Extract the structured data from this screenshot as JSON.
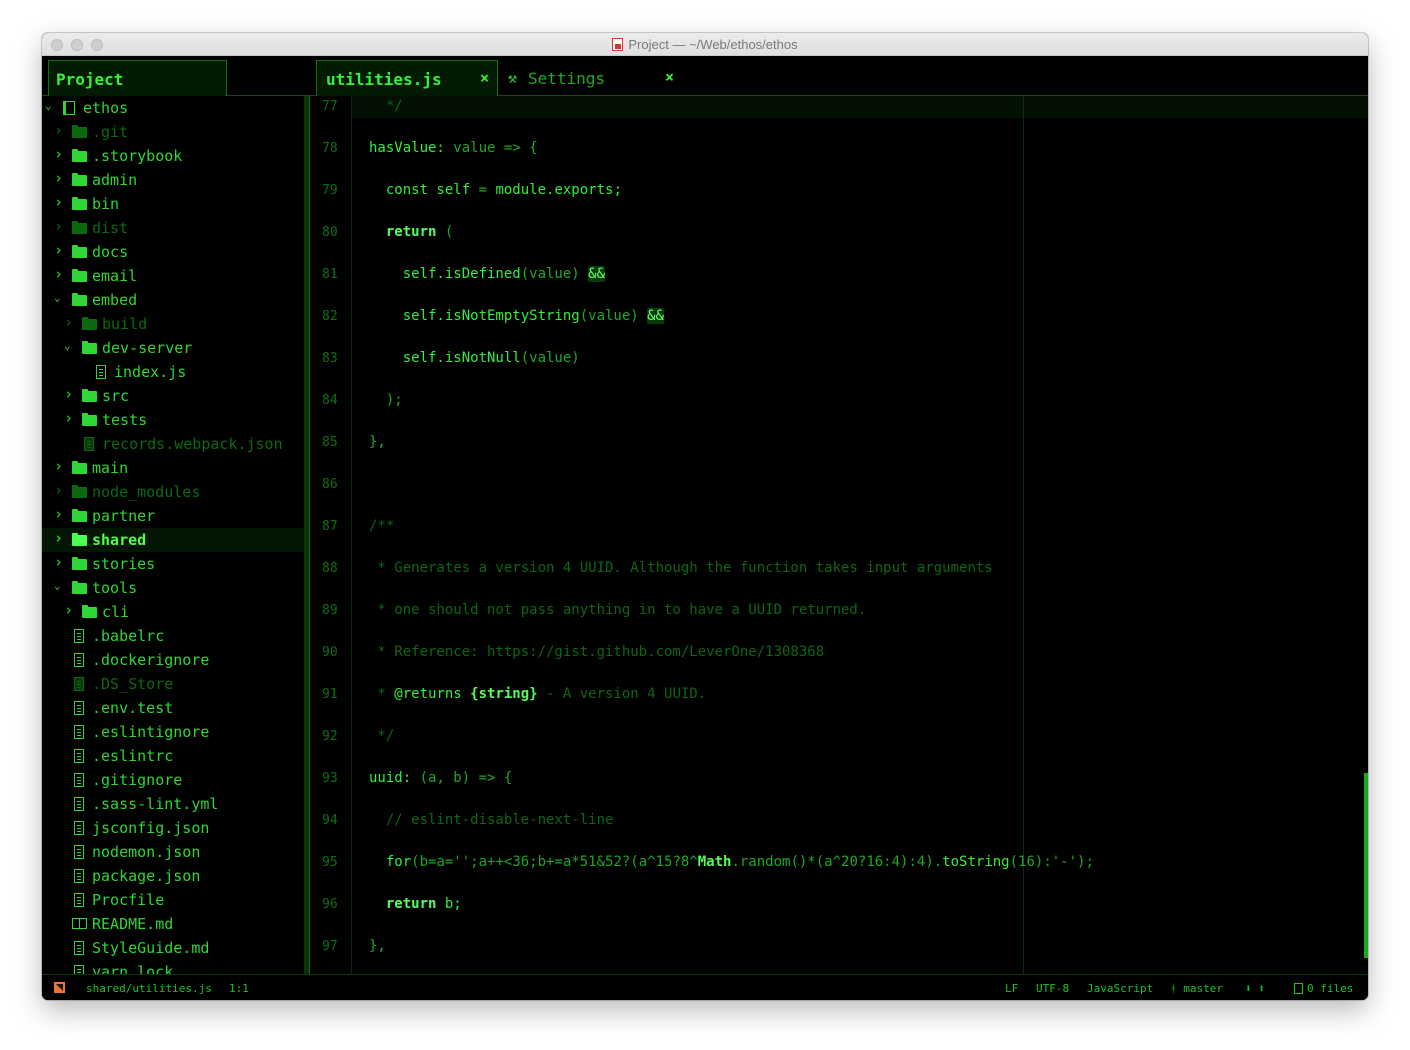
{
  "window": {
    "title": "Project — ~/Web/ethos/ethos"
  },
  "tree": {
    "tab_label": "Project",
    "items": [
      {
        "label": "ethos",
        "kind": "book",
        "depth": 0,
        "expanded": true,
        "state": "normal"
      },
      {
        "label": ".git",
        "kind": "folder",
        "depth": 1,
        "expanded": false,
        "state": "dim"
      },
      {
        "label": ".storybook",
        "kind": "folder",
        "depth": 1,
        "expanded": false,
        "state": "normal"
      },
      {
        "label": "admin",
        "kind": "folder",
        "depth": 1,
        "expanded": false,
        "state": "normal"
      },
      {
        "label": "bin",
        "kind": "folder",
        "depth": 1,
        "expanded": false,
        "state": "normal"
      },
      {
        "label": "dist",
        "kind": "folder",
        "depth": 1,
        "expanded": false,
        "state": "dim"
      },
      {
        "label": "docs",
        "kind": "folder",
        "depth": 1,
        "expanded": false,
        "state": "normal"
      },
      {
        "label": "email",
        "kind": "folder",
        "depth": 1,
        "expanded": false,
        "state": "normal"
      },
      {
        "label": "embed",
        "kind": "folder",
        "depth": 1,
        "expanded": true,
        "state": "normal"
      },
      {
        "label": "build",
        "kind": "folder",
        "depth": 2,
        "expanded": false,
        "state": "dim"
      },
      {
        "label": "dev-server",
        "kind": "folder",
        "depth": 2,
        "expanded": true,
        "state": "normal"
      },
      {
        "label": "index.js",
        "kind": "file",
        "depth": 3,
        "state": "normal"
      },
      {
        "label": "src",
        "kind": "folder",
        "depth": 2,
        "expanded": false,
        "state": "normal"
      },
      {
        "label": "tests",
        "kind": "folder",
        "depth": 2,
        "expanded": false,
        "state": "normal"
      },
      {
        "label": "records.webpack.json",
        "kind": "file",
        "depth": 2,
        "state": "dim"
      },
      {
        "label": "main",
        "kind": "folder",
        "depth": 1,
        "expanded": false,
        "state": "normal"
      },
      {
        "label": "node_modules",
        "kind": "folder",
        "depth": 1,
        "expanded": false,
        "state": "dim"
      },
      {
        "label": "partner",
        "kind": "folder",
        "depth": 1,
        "expanded": false,
        "state": "normal"
      },
      {
        "label": "shared",
        "kind": "folder",
        "depth": 1,
        "expanded": false,
        "state": "bold"
      },
      {
        "label": "stories",
        "kind": "folder",
        "depth": 1,
        "expanded": false,
        "state": "normal"
      },
      {
        "label": "tools",
        "kind": "folder",
        "depth": 1,
        "expanded": true,
        "state": "normal"
      },
      {
        "label": "cli",
        "kind": "folder",
        "depth": 2,
        "expanded": false,
        "state": "normal"
      },
      {
        "label": ".babelrc",
        "kind": "file",
        "depth": 1,
        "state": "normal"
      },
      {
        "label": ".dockerignore",
        "kind": "file",
        "depth": 1,
        "state": "normal"
      },
      {
        "label": ".DS_Store",
        "kind": "file",
        "depth": 1,
        "state": "dim"
      },
      {
        "label": ".env.test",
        "kind": "file",
        "depth": 1,
        "state": "normal"
      },
      {
        "label": ".eslintignore",
        "kind": "file",
        "depth": 1,
        "state": "normal"
      },
      {
        "label": ".eslintrc",
        "kind": "file",
        "depth": 1,
        "state": "normal"
      },
      {
        "label": ".gitignore",
        "kind": "file",
        "depth": 1,
        "state": "normal"
      },
      {
        "label": ".sass-lint.yml",
        "kind": "file",
        "depth": 1,
        "state": "normal"
      },
      {
        "label": "jsconfig.json",
        "kind": "file",
        "depth": 1,
        "state": "normal"
      },
      {
        "label": "nodemon.json",
        "kind": "file",
        "depth": 1,
        "state": "normal"
      },
      {
        "label": "package.json",
        "kind": "file",
        "depth": 1,
        "state": "normal"
      },
      {
        "label": "Procfile",
        "kind": "file",
        "depth": 1,
        "state": "normal"
      },
      {
        "label": "README.md",
        "kind": "readme",
        "depth": 1,
        "state": "normal"
      },
      {
        "label": "StyleGuide.md",
        "kind": "file",
        "depth": 1,
        "state": "normal"
      },
      {
        "label": "yarn.lock",
        "kind": "file",
        "depth": 1,
        "state": "normal"
      }
    ]
  },
  "tabs": [
    {
      "label": "utilities.js",
      "active": true,
      "close": "×"
    },
    {
      "label": "Settings",
      "active": false,
      "icon": "wrench-icon",
      "close": "×"
    }
  ],
  "editor": {
    "lines": [
      {
        "n": "77",
        "segs": [
          {
            "t": "  */",
            "c": "c"
          }
        ]
      },
      {
        "n": "78",
        "segs": [
          {
            "t": "hasValue: "
          },
          {
            "t": "value",
            "c": "dim2"
          },
          {
            "t": " => {",
            "c": "dim2"
          }
        ]
      },
      {
        "n": "79",
        "segs": [
          {
            "t": "  const self "
          },
          {
            "t": "= ",
            "c": "dim2"
          },
          {
            "t": "module.exports;"
          }
        ]
      },
      {
        "n": "80",
        "segs": [
          {
            "t": "  "
          },
          {
            "t": "return",
            "c": "b"
          },
          {
            "t": " (",
            "c": "dim2"
          }
        ]
      },
      {
        "n": "81",
        "segs": [
          {
            "t": "    self.isDefined"
          },
          {
            "t": "(value) ",
            "c": "dim2"
          },
          {
            "t": "&&",
            "c": "hl"
          }
        ]
      },
      {
        "n": "82",
        "segs": [
          {
            "t": "    self.isNotEmptyString"
          },
          {
            "t": "(value) ",
            "c": "dim2"
          },
          {
            "t": "&&",
            "c": "hl"
          }
        ]
      },
      {
        "n": "83",
        "segs": [
          {
            "t": "    self.isNotNull"
          },
          {
            "t": "(value)",
            "c": "dim2"
          }
        ]
      },
      {
        "n": "84",
        "segs": [
          {
            "t": "  );",
            "c": "dim2"
          }
        ]
      },
      {
        "n": "85",
        "segs": [
          {
            "t": "},",
            "c": "dim2"
          }
        ]
      },
      {
        "n": "86",
        "segs": [
          {
            "t": ""
          }
        ]
      },
      {
        "n": "87",
        "segs": [
          {
            "t": "/**",
            "c": "c"
          }
        ]
      },
      {
        "n": "88",
        "segs": [
          {
            "t": " * Generates a version 4 UUID. Although the function takes input arguments",
            "c": "c"
          }
        ]
      },
      {
        "n": "89",
        "segs": [
          {
            "t": " * one should not pass anything in to have a UUID returned.",
            "c": "c"
          }
        ]
      },
      {
        "n": "90",
        "segs": [
          {
            "t": " * Reference: https://gist.github.com/LeverOne/1308368",
            "c": "c"
          }
        ]
      },
      {
        "n": "91",
        "segs": [
          {
            "t": " * ",
            "c": "c"
          },
          {
            "t": "@returns "
          },
          {
            "t": "{string}",
            "c": "b"
          },
          {
            "t": " - A version 4 UUID.",
            "c": "c"
          }
        ]
      },
      {
        "n": "92",
        "segs": [
          {
            "t": " */",
            "c": "c"
          }
        ]
      },
      {
        "n": "93",
        "segs": [
          {
            "t": "uuid: "
          },
          {
            "t": "(a, b) => {",
            "c": "dim2"
          }
        ]
      },
      {
        "n": "94",
        "segs": [
          {
            "t": "  // eslint-disable-next-line",
            "c": "c"
          }
        ]
      },
      {
        "n": "95",
        "segs": [
          {
            "t": "  for"
          },
          {
            "t": "(b=a='';a++<36;b+=a*51&52?(a^15?8^",
            "c": "dim2"
          },
          {
            "t": "Math",
            "c": "b"
          },
          {
            "t": ".random()*(a^20?16:4):4).",
            "c": "dim2"
          },
          {
            "t": "toString"
          },
          {
            "t": "(16):'-');",
            "c": "dim2"
          }
        ]
      },
      {
        "n": "96",
        "segs": [
          {
            "t": "  "
          },
          {
            "t": "return",
            "c": "b"
          },
          {
            "t": " b;"
          }
        ]
      },
      {
        "n": "97",
        "segs": [
          {
            "t": "},",
            "c": "dim2"
          }
        ]
      }
    ]
  },
  "status": {
    "path": "shared/utilities.js",
    "cursor": "1:1",
    "line_ending": "LF",
    "encoding": "UTF-8",
    "grammar": "JavaScript",
    "branch": "master",
    "arrows": "⬇ ⬆",
    "files": "0 files"
  }
}
